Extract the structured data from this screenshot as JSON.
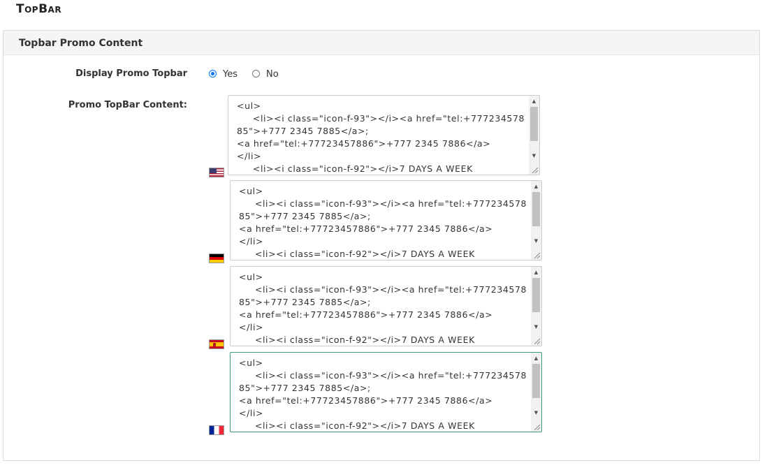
{
  "page": {
    "title": "TopBar"
  },
  "panel": {
    "header": "Topbar Promo Content"
  },
  "display_promo": {
    "label": "Display Promo Topbar",
    "options": [
      {
        "label": "Yes",
        "selected": true
      },
      {
        "label": "No",
        "selected": false
      }
    ]
  },
  "promo_content": {
    "label": "Promo TopBar Content:",
    "editors": [
      {
        "language": "English",
        "flag_icon": "us-flag-icon",
        "value": "<ul>\n     <li><i class=\"icon-f-93\"></i><a href=\"tel:+77723457885\">+777 2345 7885</a>;\n<a href=\"tel:+77723457886\">+777 2345 7886</a>\n</li>\n     <li><i class=\"icon-f-92\"></i>7 DAYS A WEEK",
        "focused": false
      },
      {
        "language": "German",
        "flag_icon": "de-flag-icon",
        "value": "<ul>\n     <li><i class=\"icon-f-93\"></i><a href=\"tel:+77723457885\">+777 2345 7885</a>;\n<a href=\"tel:+77723457886\">+777 2345 7886</a>\n</li>\n     <li><i class=\"icon-f-92\"></i>7 DAYS A WEEK",
        "focused": false
      },
      {
        "language": "Spanish",
        "flag_icon": "es-flag-icon",
        "value": "<ul>\n     <li><i class=\"icon-f-93\"></i><a href=\"tel:+77723457885\">+777 2345 7885</a>;\n<a href=\"tel:+77723457886\">+777 2345 7886</a>\n</li>\n     <li><i class=\"icon-f-92\"></i>7 DAYS A WEEK",
        "focused": false
      },
      {
        "language": "French",
        "flag_icon": "fr-flag-icon",
        "value": "<ul>\n     <li><i class=\"icon-f-93\"></i><a href=\"tel:+77723457885\">+777 2345 7885</a>;\n<a href=\"tel:+77723457886\">+777 2345 7886</a>\n</li>\n     <li><i class=\"icon-f-92\"></i>7 DAYS A WEEK",
        "focused": true
      }
    ]
  },
  "colors": {
    "radio_accent": "#0075ff",
    "focus_border": "#3c9a7a",
    "panel_header_bg": "#f5f5f5"
  }
}
